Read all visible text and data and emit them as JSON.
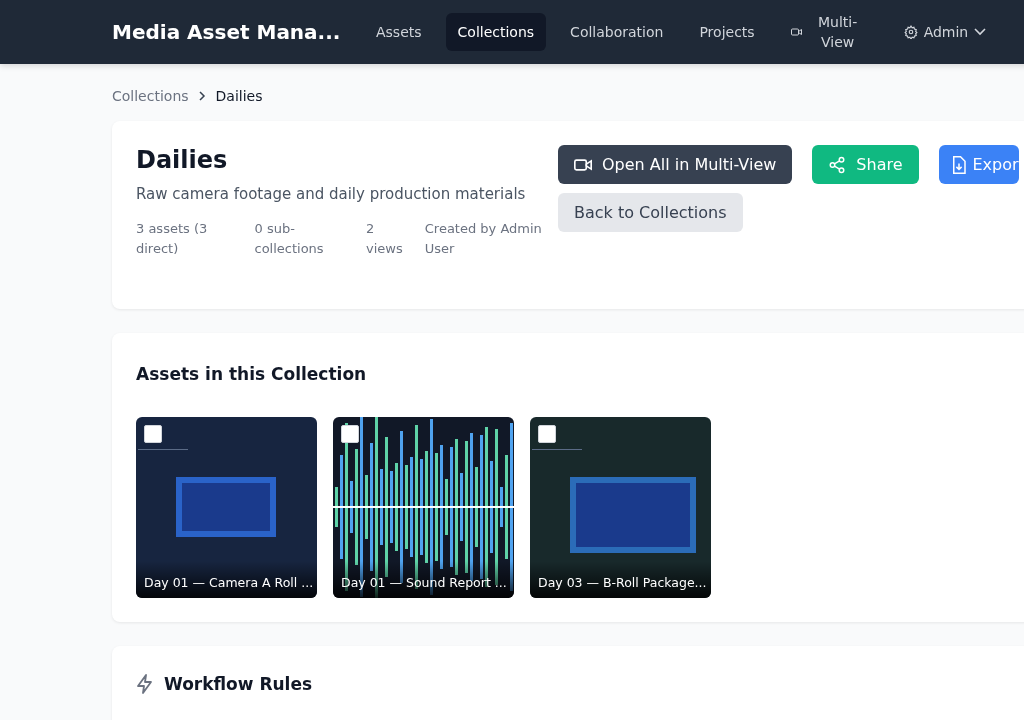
{
  "nav": {
    "brand": "Media Asset Mana...",
    "items": [
      {
        "label": "Assets",
        "selected": false,
        "kind": "link"
      },
      {
        "label": "Collections",
        "selected": true,
        "kind": "link"
      },
      {
        "label": "Collaboration",
        "selected": false,
        "kind": "link"
      },
      {
        "label": "Projects",
        "selected": false,
        "kind": "link"
      },
      {
        "label": "Multi-View",
        "selected": false,
        "kind": "video"
      },
      {
        "label": "Admin",
        "selected": false,
        "kind": "menu"
      }
    ]
  },
  "breadcrumb": [
    "Collections",
    "Dailies"
  ],
  "collection": {
    "title": "Dailies",
    "description": "Raw camera footage and daily production materials",
    "meta": [
      "3 assets (3 direct)",
      "0 sub-collections",
      "2 views",
      "Created by Admin User"
    ],
    "actions": [
      {
        "label": "Open All in Multi-View",
        "kind": "multiview"
      },
      {
        "label": "Share",
        "kind": "share"
      },
      {
        "label": "Expor",
        "kind": "export"
      },
      {
        "label": "Back to Collections",
        "kind": "back"
      }
    ]
  },
  "assets_section": {
    "title": "Assets in this Collection",
    "assets": [
      {
        "title": "Day 01 — Camera A Roll ...",
        "checked": false
      },
      {
        "title": "Day 01 — Sound Report ...",
        "kind": "audio",
        "checked": false
      },
      {
        "title": "Day 03 — B-Roll Package...",
        "kind": "image2",
        "checked": false
      }
    ]
  },
  "workflow": {
    "title": "Workflow Rules"
  }
}
